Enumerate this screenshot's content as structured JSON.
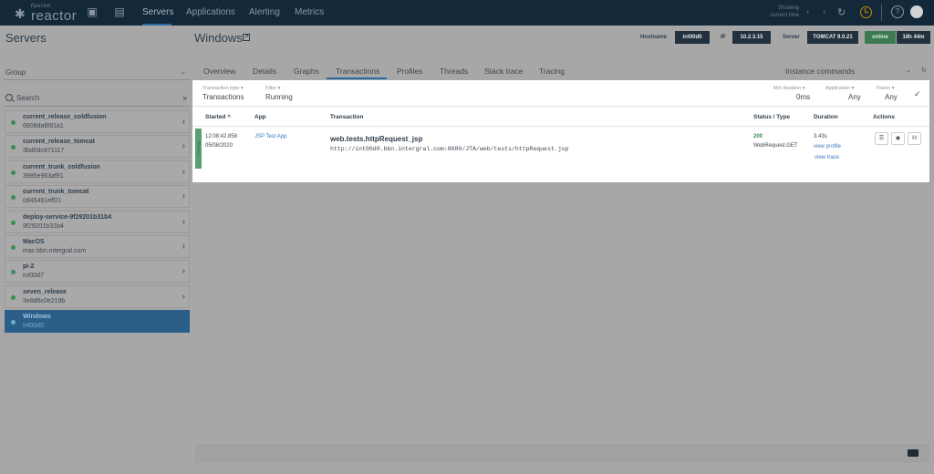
{
  "topbar": {
    "logo_small": "fusion",
    "logo_main": "reactor",
    "nav": [
      "Servers",
      "Applications",
      "Alerting",
      "Metrics"
    ],
    "showing_line1": "Showing",
    "showing_line2": "current time",
    "icons": [
      "dashboard-icon",
      "notes-icon",
      "refresh-icon",
      "clock-icon",
      "help-icon",
      "user-avatar"
    ]
  },
  "page": {
    "title": "Servers",
    "server_title": "Windows"
  },
  "server_info": {
    "hostname_label": "Hostname",
    "hostname": "int00d0",
    "ip_label": "IP",
    "ip": "10.2.3.15",
    "server_label": "Server",
    "server": "TOMCAT 9.0.21",
    "status": "online",
    "uptime": "18h 44m"
  },
  "sidebar": {
    "group_label": "Group",
    "search_placeholder": "Search",
    "servers": [
      {
        "name": "current_release_coldfusion",
        "id": "6808daf891a1"
      },
      {
        "name": "current_release_tomcat",
        "id": "3bd0dc871117"
      },
      {
        "name": "current_trunk_coldfusion",
        "id": "3985e963af81"
      },
      {
        "name": "current_trunk_tomcat",
        "id": "0d45491eff21"
      },
      {
        "name": "deploy-service-9f29201b31b4",
        "id": "9f29201b31b4"
      },
      {
        "name": "MacOS",
        "id": "mac.bbn.intergral.com"
      },
      {
        "name": "pi-2",
        "id": "int00d7"
      },
      {
        "name": "seven_release",
        "id": "3e8d6c0e219b"
      },
      {
        "name": "Windows",
        "id": "int00d0"
      }
    ]
  },
  "tabs": [
    "Overview",
    "Details",
    "Graphs",
    "Transactions",
    "Profiles",
    "Threads",
    "Stack trace",
    "Tracing"
  ],
  "instance_commands": "Instance commands",
  "filters": {
    "transaction_type_label": "Transaction type",
    "transaction_type": "Transactions",
    "filter_label": "Filter",
    "filter": "Running",
    "min_duration_label": "Min duration",
    "min_duration": "0ms",
    "application_label": "Application",
    "application": "Any",
    "flavor_label": "Flavor",
    "flavor": "Any"
  },
  "table": {
    "headers": {
      "started": "Started",
      "app": "App",
      "transaction": "Transaction",
      "status_type": "Status / Type",
      "duration": "Duration",
      "actions": "Actions"
    },
    "row": {
      "state": "Running",
      "time": "12:08:42.858",
      "date": "05/08/2020",
      "app": "JSP Test App",
      "transaction": "web.tests.httpRequest_jsp",
      "url": "http://int00d0.bbn.intergral.com:8080/JTA/web/tests/httpRequest.jsp",
      "status": "200",
      "type": "WebRequest.GET",
      "duration": "3.43s",
      "view_profile": "view profile",
      "view_trace": "view trace"
    }
  }
}
